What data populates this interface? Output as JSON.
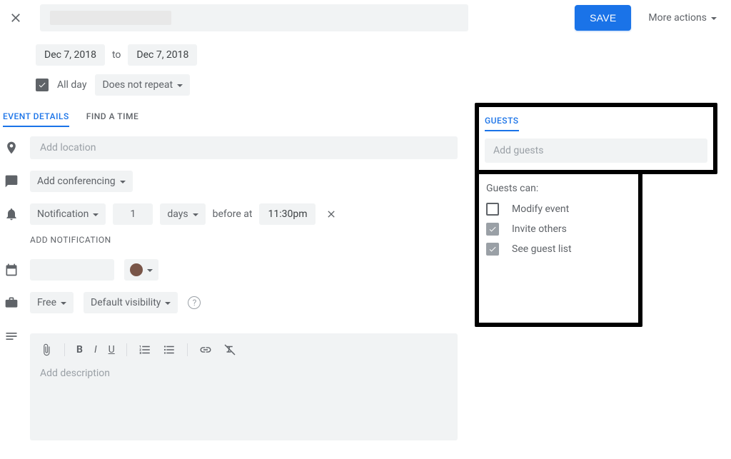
{
  "header": {
    "save_label": "SAVE",
    "more_actions_label": "More actions"
  },
  "dates": {
    "start": "Dec 7, 2018",
    "to": "to",
    "end": "Dec 7, 2018"
  },
  "allday": {
    "label": "All day",
    "repeat": "Does not repeat"
  },
  "tabs": {
    "event_details": "EVENT DETAILS",
    "find_a_time": "FIND A TIME"
  },
  "location": {
    "placeholder": "Add location"
  },
  "conferencing": {
    "label": "Add conferencing"
  },
  "notification": {
    "type": "Notification",
    "amount": "1",
    "unit": "days",
    "before_at": "before at",
    "time": "11:30pm",
    "add_label": "ADD NOTIFICATION"
  },
  "availability": {
    "status": "Free",
    "visibility": "Default visibility"
  },
  "description": {
    "placeholder": "Add description"
  },
  "guests": {
    "tab_label": "GUESTS",
    "input_placeholder": "Add guests",
    "perms_title": "Guests can:",
    "modify_label": "Modify event",
    "invite_label": "Invite others",
    "seelist_label": "See guest list",
    "modify_checked": false,
    "invite_checked": true,
    "seelist_checked": true
  },
  "colors": {
    "event_color": "#795548",
    "primary": "#1a73e8"
  }
}
